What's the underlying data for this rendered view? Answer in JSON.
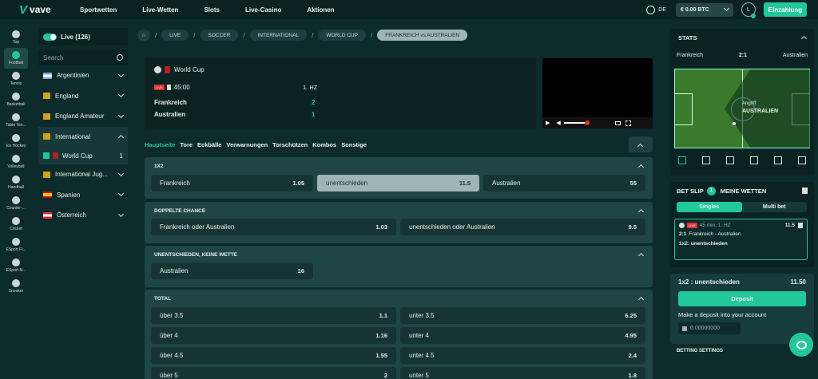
{
  "header": {
    "logo": "vave",
    "nav": [
      "Sportwetten",
      "Live-Wetten",
      "Slots",
      "Live-Casino",
      "Aktionen"
    ],
    "lang": "DE",
    "balance": "€ 0.00 BTC",
    "avatar": "L",
    "deposit": "Einzahlung"
  },
  "leftbar": [
    "Top",
    "Football",
    "Tennis",
    "Basketball",
    "Table Ten...",
    "Ice Hockey",
    "Volleyball",
    "Handball",
    "Counter-...",
    "Cricket",
    "ESport Fi...",
    "ESport N...",
    "Snooker"
  ],
  "sidebar": {
    "live": "Live (126)",
    "search_placeholder": "Search",
    "countries": [
      "Argentinien",
      "England",
      "England Amateur",
      "International"
    ],
    "sub": {
      "label": "World Cup",
      "count": "1"
    },
    "countries2": [
      "International Jug...",
      "Spanien",
      "Österreich"
    ]
  },
  "breadcrumb": [
    "LIVE",
    "SOCCER",
    "INTERNATIONAL",
    "WORLD CUP",
    "FRANKREICH vs AUSTRALIEN"
  ],
  "match": {
    "competition": "World Cup",
    "time": "45:00",
    "period": "1. HZ",
    "home": "Frankreich",
    "away": "Australien",
    "home_score": "2",
    "away_score": "1"
  },
  "tabs": [
    "Hauptseite",
    "Tore",
    "Eckbälle",
    "Verwarnungen",
    "Torschützen",
    "Kombos",
    "Sonstige"
  ],
  "markets": {
    "m1": {
      "title": "1X2",
      "odds": [
        [
          "Frankreich",
          "1.05"
        ],
        [
          "unentschieden",
          "11.5"
        ],
        [
          "Australien",
          "55"
        ]
      ]
    },
    "m2": {
      "title": "DOPPELTE CHANCE",
      "odds": [
        [
          "Frankreich oder Australien",
          "1.03"
        ],
        [
          "unentschieden oder Australien",
          "9.5"
        ]
      ]
    },
    "m3": {
      "title": "UNENTSCHIEDEN, KEINE WETTE",
      "odds": [
        [
          "Australien",
          "16"
        ]
      ]
    },
    "m4": {
      "title": "TOTAL",
      "odds": [
        [
          "über 3.5",
          "1.1"
        ],
        [
          "unter 3.5",
          "6.25"
        ],
        [
          "über 4",
          "1.16"
        ],
        [
          "unter 4",
          "4.95"
        ],
        [
          "über 4.5",
          "1.55"
        ],
        [
          "unter 4.5",
          "2.4"
        ],
        [
          "über 5",
          "2"
        ],
        [
          "unter 5",
          "1.8"
        ]
      ]
    }
  },
  "stats": {
    "title": "STATS",
    "home": "Frankreich",
    "score": "2:1",
    "away": "Australien",
    "attack": "Angriff",
    "attack_team": "AUSTRALIEN"
  },
  "betslip": {
    "title": "BET SLIP",
    "count": "1",
    "my_bets": "MEINE WETTEN",
    "singles": "Singles",
    "multi": "Multi bet",
    "live": "45 min, 1. HZ",
    "odds": "11.5",
    "score": "2:1",
    "match": "Frankreich - Australien",
    "pick": "1x2: unentschieden"
  },
  "summary": {
    "pick": "1x2 : unentschieden",
    "odds": "11.50",
    "deposit": "Deposit",
    "text": "Make a deposit into your account",
    "balance": "0.00000000",
    "settings": "BETTING SETTINGS"
  }
}
